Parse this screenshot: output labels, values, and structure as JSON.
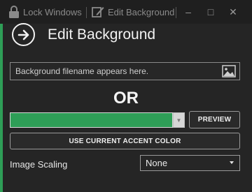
{
  "titlebar": {
    "lock_label": "Lock Windows",
    "edit_label": "Edit Background",
    "minimize": "–",
    "maximize": "□",
    "close": "✕"
  },
  "page": {
    "title": "Edit Background"
  },
  "filename": {
    "placeholder": "Background filename appears here."
  },
  "divider_text": "OR",
  "color": {
    "swatch": "#2e9e57",
    "dropdown_arrow": "▼"
  },
  "buttons": {
    "preview": "PREVIEW",
    "use_accent": "USE CURRENT ACCENT COLOR"
  },
  "scaling": {
    "label": "Image Scaling",
    "value": "None"
  },
  "icons": {
    "lock": "lock-icon",
    "edit": "edit-icon",
    "back": "back-arrow-icon",
    "image": "image-icon"
  }
}
